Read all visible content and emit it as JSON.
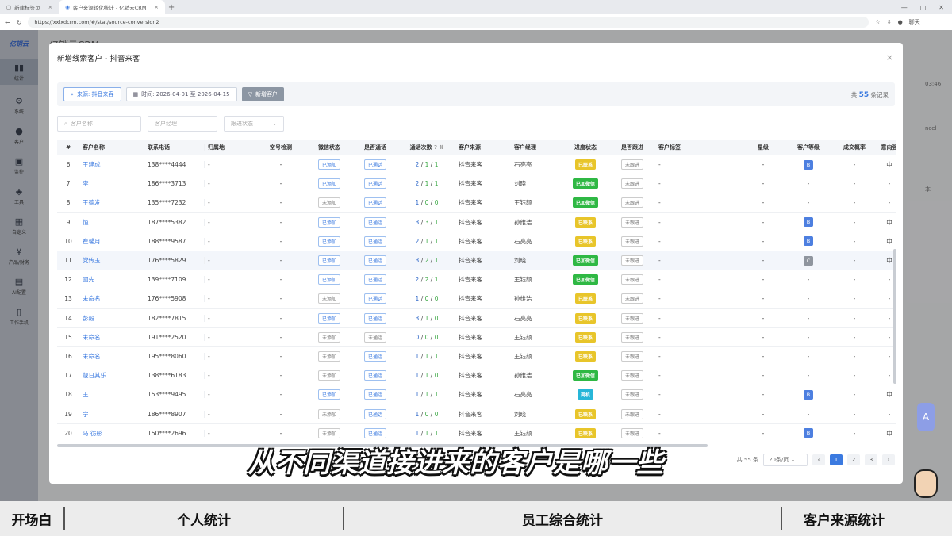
{
  "browser": {
    "tabs": [
      {
        "label": "新建标签页",
        "active": false
      },
      {
        "label": "客户来源转化统计 - 亿销云CRM",
        "active": true
      }
    ],
    "url": "https://xxlxdcrm.com/#/stat/source-conversion2",
    "profile_label": "聊天"
  },
  "sidebar": {
    "logo": "亿销云",
    "items": [
      {
        "icon": "stats-icon",
        "label": "统计"
      },
      {
        "icon": "gear-icon",
        "label": "系统"
      },
      {
        "icon": "user-icon",
        "label": "客户"
      },
      {
        "icon": "monitor-icon",
        "label": "监控"
      },
      {
        "icon": "cube-icon",
        "label": "工具"
      },
      {
        "icon": "grid-icon",
        "label": "自定义"
      },
      {
        "icon": "yen-icon",
        "label": "产品/财务"
      },
      {
        "icon": "robot-icon",
        "label": "AI配置"
      },
      {
        "icon": "phone-icon",
        "label": "工作手机"
      }
    ]
  },
  "background": {
    "app_title": "亿销云CRM",
    "right_text1": "03:46",
    "right_text2": "ncel",
    "right_text3": "本"
  },
  "modal": {
    "title": "新增线索客户 - 抖音来客",
    "close": "×",
    "filters": {
      "source": "来源: 抖音来客",
      "date_range": "时间: 2026-04-01 至 2026-04-15",
      "new_customer_button": "新增客户",
      "total_prefix": "共",
      "total_count": "55",
      "total_suffix": "条记录"
    },
    "search": {
      "customer_name_placeholder": "客户名称",
      "manager_placeholder": "客户经理",
      "progress_placeholder": "跟进状态"
    },
    "columns": [
      "#",
      "客户名称",
      "联系电话",
      "归属地",
      "空号检测",
      "微信状态",
      "是否通话",
      "通话次数",
      "客户来源",
      "客户经理",
      "进度状态",
      "是否跟进",
      "客户标签",
      "星级",
      "客户等级",
      "成交概率",
      "意向强"
    ],
    "rows": [
      {
        "num": "6",
        "name": "王建成",
        "phone": "138****4444",
        "loc": "-",
        "chk": "-",
        "wx": "已添加",
        "call": "已通话",
        "c1": "2",
        "c2": "1",
        "c3": "1",
        "src": "抖音来客",
        "mgr": "石亮亮",
        "prog": "已联系",
        "progColor": "#e8c52a",
        "follow": "未跟进",
        "tag": "-",
        "star": "-",
        "lvl": "B",
        "lvlColor": "#4d7fe0",
        "prob": "-",
        "intent": "中"
      },
      {
        "num": "7",
        "name": "李",
        "phone": "186****3713",
        "loc": "-",
        "chk": "-",
        "wx": "已添加",
        "call": "已通话",
        "c1": "2",
        "c2": "1",
        "c3": "1",
        "src": "抖音来客",
        "mgr": "刘晓",
        "prog": "已加微信",
        "progColor": "#2fb844",
        "follow": "未跟进",
        "tag": "-",
        "star": "-",
        "lvl": "-",
        "lvlColor": "",
        "prob": "-",
        "intent": "-"
      },
      {
        "num": "8",
        "name": "王德发",
        "phone": "135****7232",
        "loc": "-",
        "chk": "-",
        "wx": "未添加",
        "call": "已通话",
        "c1": "1",
        "c2": "0",
        "c3": "0",
        "src": "抖音来客",
        "mgr": "王钰颉",
        "prog": "已加微信",
        "progColor": "#2fb844",
        "follow": "未跟进",
        "tag": "-",
        "star": "-",
        "lvl": "-",
        "lvlColor": "",
        "prob": "-",
        "intent": "-"
      },
      {
        "num": "9",
        "name": "恒",
        "phone": "187****5382",
        "loc": "-",
        "chk": "-",
        "wx": "已添加",
        "call": "已通话",
        "c1": "3",
        "c2": "3",
        "c3": "1",
        "src": "抖音来客",
        "mgr": "孙维洁",
        "prog": "已联系",
        "progColor": "#e8c52a",
        "follow": "未跟进",
        "tag": "-",
        "star": "-",
        "lvl": "B",
        "lvlColor": "#4d7fe0",
        "prob": "-",
        "intent": "中"
      },
      {
        "num": "10",
        "name": "崔馨月",
        "phone": "188****9587",
        "loc": "-",
        "chk": "-",
        "wx": "已添加",
        "call": "已通话",
        "c1": "2",
        "c2": "1",
        "c3": "1",
        "src": "抖音来客",
        "mgr": "石亮亮",
        "prog": "已联系",
        "progColor": "#e8c52a",
        "follow": "未跟进",
        "tag": "-",
        "star": "-",
        "lvl": "B",
        "lvlColor": "#4d7fe0",
        "prob": "-",
        "intent": "中"
      },
      {
        "num": "11",
        "name": "党传玉",
        "phone": "176****5829",
        "loc": "-",
        "chk": "-",
        "wx": "已添加",
        "call": "已通话",
        "c1": "3",
        "c2": "2",
        "c3": "1",
        "src": "抖音来客",
        "mgr": "刘晓",
        "prog": "已加微信",
        "progColor": "#2fb844",
        "follow": "未跟进",
        "tag": "-",
        "star": "-",
        "lvl": "C",
        "lvlColor": "#8f959e",
        "prob": "-",
        "intent": "中"
      },
      {
        "num": "12",
        "name": "國先",
        "phone": "139****7109",
        "loc": "-",
        "chk": "-",
        "wx": "已添加",
        "call": "已通话",
        "c1": "2",
        "c2": "2",
        "c3": "1",
        "src": "抖音来客",
        "mgr": "王钰颉",
        "prog": "已加微信",
        "progColor": "#2fb844",
        "follow": "未跟进",
        "tag": "-",
        "star": "-",
        "lvl": "-",
        "lvlColor": "",
        "prob": "-",
        "intent": "-"
      },
      {
        "num": "13",
        "name": "未命名",
        "phone": "176****5908",
        "loc": "-",
        "chk": "-",
        "wx": "未添加",
        "call": "已通话",
        "c1": "1",
        "c2": "0",
        "c3": "0",
        "src": "抖音来客",
        "mgr": "孙维洁",
        "prog": "已联系",
        "progColor": "#e8c52a",
        "follow": "未跟进",
        "tag": "-",
        "star": "-",
        "lvl": "-",
        "lvlColor": "",
        "prob": "-",
        "intent": "-"
      },
      {
        "num": "14",
        "name": "彭毅",
        "phone": "182****7815",
        "loc": "-",
        "chk": "-",
        "wx": "已添加",
        "call": "已通话",
        "c1": "3",
        "c2": "1",
        "c3": "0",
        "src": "抖音来客",
        "mgr": "石亮亮",
        "prog": "已联系",
        "progColor": "#e8c52a",
        "follow": "未跟进",
        "tag": "-",
        "star": "-",
        "lvl": "-",
        "lvlColor": "",
        "prob": "-",
        "intent": "-"
      },
      {
        "num": "15",
        "name": "未命名",
        "phone": "191****2520",
        "loc": "-",
        "chk": "-",
        "wx": "未添加",
        "call": "未通话",
        "c1": "0",
        "c2": "0",
        "c3": "0",
        "src": "抖音来客",
        "mgr": "王钰颉",
        "prog": "已联系",
        "progColor": "#e8c52a",
        "follow": "未跟进",
        "tag": "-",
        "star": "-",
        "lvl": "-",
        "lvlColor": "",
        "prob": "-",
        "intent": "-"
      },
      {
        "num": "16",
        "name": "未命名",
        "phone": "195****8060",
        "loc": "-",
        "chk": "-",
        "wx": "未添加",
        "call": "已通话",
        "c1": "1",
        "c2": "1",
        "c3": "1",
        "src": "抖音来客",
        "mgr": "王钰颉",
        "prog": "已联系",
        "progColor": "#e8c52a",
        "follow": "未跟进",
        "tag": "-",
        "star": "-",
        "lvl": "-",
        "lvlColor": "",
        "prob": "-",
        "intent": "-"
      },
      {
        "num": "17",
        "name": "靓日其乐",
        "phone": "138****6183",
        "loc": "-",
        "chk": "-",
        "wx": "未添加",
        "call": "已通话",
        "c1": "1",
        "c2": "1",
        "c3": "0",
        "src": "抖音来客",
        "mgr": "孙维洁",
        "prog": "已加微信",
        "progColor": "#2fb844",
        "follow": "未跟进",
        "tag": "-",
        "star": "-",
        "lvl": "-",
        "lvlColor": "",
        "prob": "-",
        "intent": "-"
      },
      {
        "num": "18",
        "name": "王",
        "phone": "153****9495",
        "loc": "-",
        "chk": "-",
        "wx": "已添加",
        "call": "已通话",
        "c1": "1",
        "c2": "1",
        "c3": "1",
        "src": "抖音来客",
        "mgr": "石亮亮",
        "prog": "商机",
        "progColor": "#27b6d8",
        "follow": "未跟进",
        "tag": "-",
        "star": "-",
        "lvl": "B",
        "lvlColor": "#4d7fe0",
        "prob": "-",
        "intent": "中"
      },
      {
        "num": "19",
        "name": "宁",
        "phone": "186****8907",
        "loc": "-",
        "chk": "-",
        "wx": "未添加",
        "call": "已通话",
        "c1": "1",
        "c2": "0",
        "c3": "0",
        "src": "抖音来客",
        "mgr": "刘晓",
        "prog": "已联系",
        "progColor": "#e8c52a",
        "follow": "未跟进",
        "tag": "-",
        "star": "-",
        "lvl": "-",
        "lvlColor": "",
        "prob": "-",
        "intent": "-"
      },
      {
        "num": "20",
        "name": "马 彷彤",
        "phone": "150****2696",
        "loc": "-",
        "chk": "-",
        "wx": "未添加",
        "call": "已通话",
        "c1": "1",
        "c2": "1",
        "c3": "1",
        "src": "抖音来客",
        "mgr": "王钰颉",
        "prog": "已联系",
        "progColor": "#e8c52a",
        "follow": "未跟进",
        "tag": "-",
        "star": "-",
        "lvl": "B",
        "lvlColor": "#4d7fe0",
        "prob": "-",
        "intent": "中"
      }
    ],
    "pagination": {
      "total_text": "共 55 条",
      "page_size": "20条/页",
      "pages": [
        "1",
        "2",
        "3"
      ],
      "current_page": "1"
    }
  },
  "caption": "从不同渠道接进来的客户是哪一些",
  "bottom_nav": [
    "开场白",
    "个人统计",
    "员工综合统计",
    "客户来源统计"
  ]
}
